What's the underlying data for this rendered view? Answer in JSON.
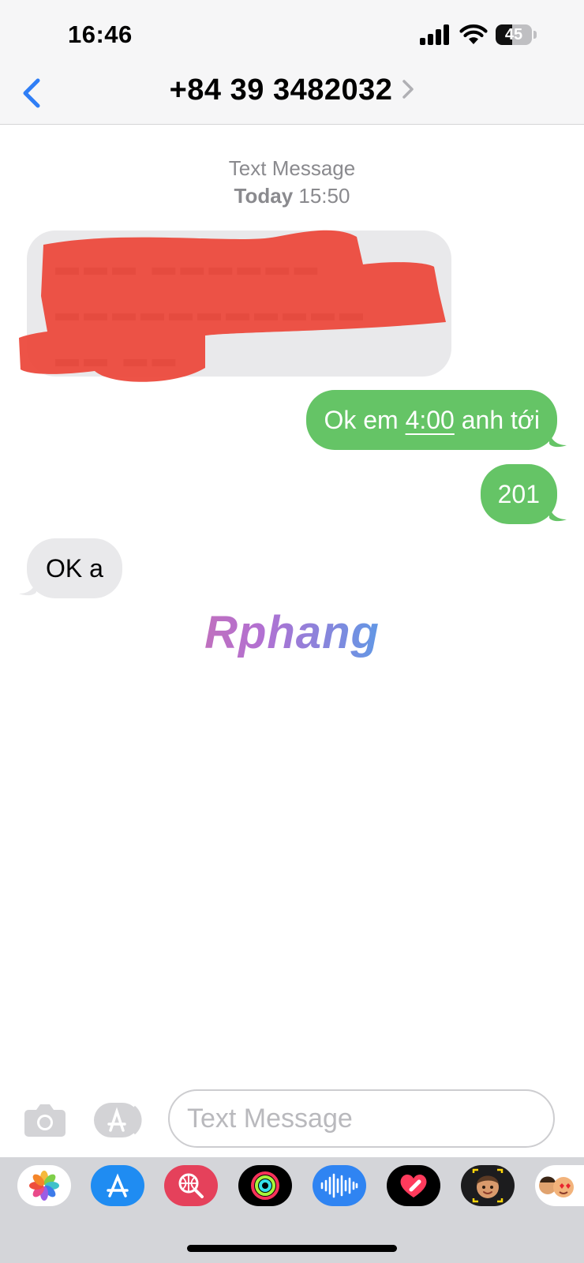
{
  "status_bar": {
    "time": "16:46",
    "battery_level": "45"
  },
  "header": {
    "contact_title": "+84 39 3482032"
  },
  "conversation": {
    "timestamp_label": "Text Message",
    "timestamp_day": "Today",
    "timestamp_time": "15:50",
    "messages": [
      {
        "direction": "incoming",
        "redacted": true
      },
      {
        "direction": "outgoing",
        "text_before": "Ok em ",
        "time_link": "4:00",
        "text_after": " anh tới"
      },
      {
        "direction": "outgoing",
        "text": "201"
      },
      {
        "direction": "incoming",
        "text": "OK a"
      }
    ]
  },
  "watermark": {
    "text": "Rphang"
  },
  "composer": {
    "placeholder": "Text Message"
  },
  "app_tray": {
    "items": [
      "photos-app-icon",
      "app-store-icon",
      "web-search-icon",
      "fitness-activity-icon",
      "audio-message-icon",
      "digital-touch-icon",
      "memoji-icon",
      "memoji-stickers-icon"
    ]
  },
  "colors": {
    "outgoing_bubble": "#65c466",
    "incoming_bubble": "#e9e9eb",
    "accent_blue": "#2f7ef6",
    "redaction": "#ec4a3d"
  }
}
